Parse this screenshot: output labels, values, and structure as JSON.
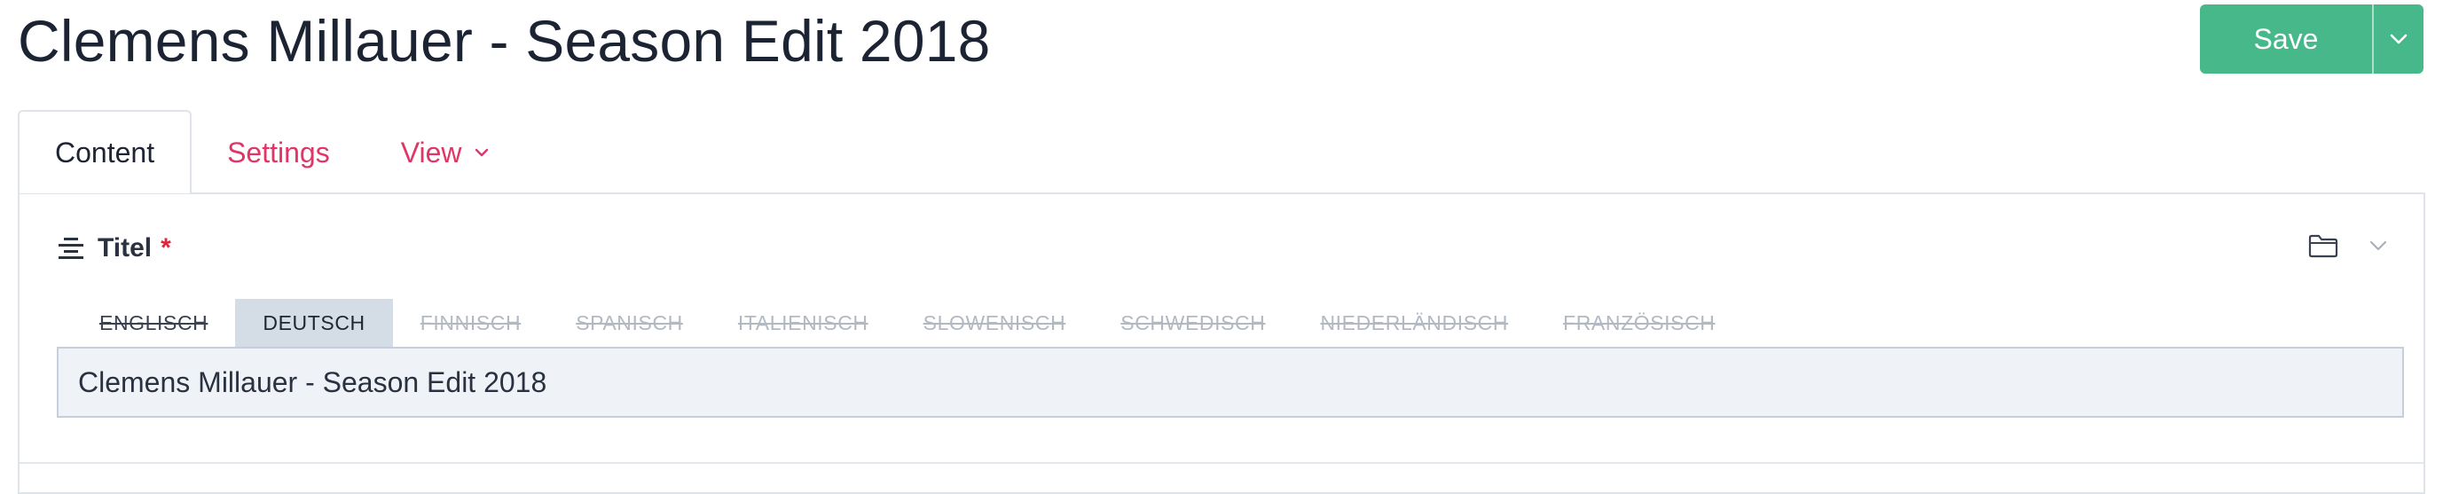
{
  "header": {
    "title": "Clemens Millauer - Season Edit 2018",
    "save_label": "Save"
  },
  "tabs": [
    {
      "label": "Content",
      "active": true
    },
    {
      "label": "Settings",
      "active": false
    },
    {
      "label": "View",
      "active": false,
      "has_dropdown": true
    }
  ],
  "field": {
    "icon": "text-align-center-icon",
    "label": "Titel",
    "required_marker": "*",
    "value": "Clemens Millauer - Season Edit 2018",
    "header_icons": [
      "folder-icon",
      "chevron-down-icon"
    ]
  },
  "languages": [
    {
      "label": "ENGLISCH",
      "state": "struck"
    },
    {
      "label": "DEUTSCH",
      "state": "selected"
    },
    {
      "label": "FINNISCH",
      "state": "struck"
    },
    {
      "label": "SPANISCH",
      "state": "struck"
    },
    {
      "label": "ITALIENISCH",
      "state": "struck"
    },
    {
      "label": "SLOWENISCH",
      "state": "struck"
    },
    {
      "label": "SCHWEDISCH",
      "state": "struck"
    },
    {
      "label": "NIEDERLÄNDISCH",
      "state": "struck"
    },
    {
      "label": "FRANZÖSISCH",
      "state": "struck"
    }
  ],
  "colors": {
    "accent_pink": "#e03566",
    "save_green": "#46b88a",
    "required_red": "#e3223c",
    "selected_lang_bg": "#d4dce6"
  }
}
